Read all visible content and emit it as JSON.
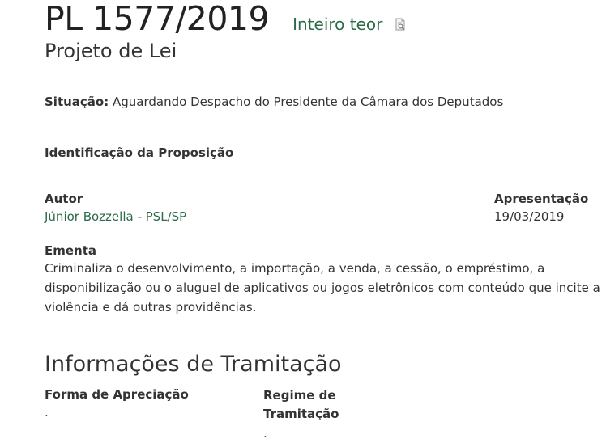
{
  "header": {
    "pl_number": "PL 1577/2019",
    "inteiro_teor_label": "Inteiro teor",
    "inteiro_teor_icon": "document-search-icon",
    "subtitle": "Projeto de Lei"
  },
  "situacao": {
    "label": "Situação:",
    "value": "Aguardando Despacho do Presidente da Câmara dos Deputados"
  },
  "identificacao": {
    "heading": "Identificação da Proposição",
    "autor_label": "Autor",
    "autor_value": "Júnior Bozzella - PSL/SP",
    "apresentacao_label": "Apresentação",
    "apresentacao_value": "19/03/2019",
    "ementa_label": "Ementa",
    "ementa_value": "Criminaliza o desenvolvimento, a importação, a venda, a cessão, o empréstimo, a disponibilização ou o aluguel de aplicativos ou jogos eletrônicos com conteúdo que incite a violência e dá outras providências."
  },
  "tramitacao": {
    "heading": "Informações de Tramitação",
    "forma_label": "Forma de Apreciação",
    "forma_value": ".",
    "regime_label": "Regime de Tramitação",
    "regime_value": "."
  },
  "colors": {
    "link": "#2c6b48",
    "text": "#333333",
    "divider": "#e2e2e2"
  }
}
